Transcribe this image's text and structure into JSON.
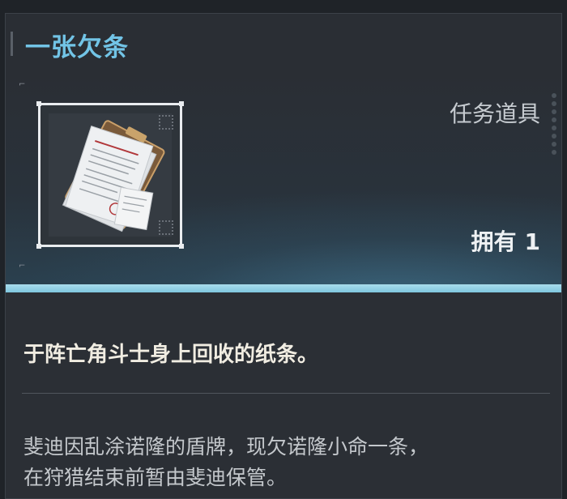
{
  "item": {
    "name": "一张欠条",
    "category": "任务道具",
    "owned_label": "拥有",
    "owned_count": "1",
    "short_description": "于阵亡角斗士身上回收的纸条。",
    "long_description_lines": [
      "斐迪因乱涂诺隆的盾牌，现欠诺隆小命一条，",
      "在狩猎结束前暂由斐迪保管。"
    ]
  },
  "colors": {
    "title": "#72c4e6",
    "accent_line": "#a9dcec",
    "panel_bg": "#2b2f35"
  },
  "icons": {
    "item": "paper-documents-icon"
  }
}
